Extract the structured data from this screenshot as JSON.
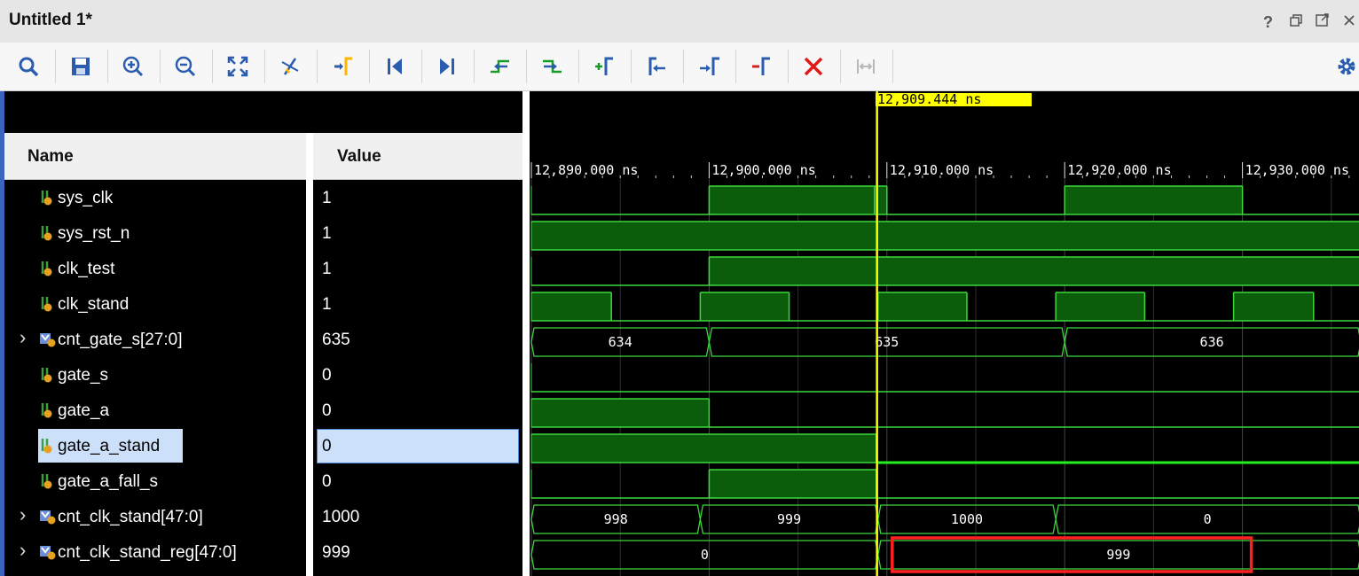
{
  "window": {
    "title": "Untitled 1*"
  },
  "title_icons": [
    "help-icon",
    "restore-icon",
    "maximize-icon",
    "close-icon"
  ],
  "toolbar": {
    "buttons": [
      {
        "name": "search-icon",
        "tooltip": "Search"
      },
      {
        "name": "save-icon",
        "tooltip": "Save Waveform Configuration"
      },
      {
        "name": "zoom-in-icon",
        "tooltip": "Zoom In"
      },
      {
        "name": "zoom-out-icon",
        "tooltip": "Zoom Out"
      },
      {
        "name": "zoom-fit-icon",
        "tooltip": "Zoom Fit"
      },
      {
        "name": "go-to-cursor-icon",
        "tooltip": "Go To Cursor"
      },
      {
        "name": "swap-cursors-icon",
        "tooltip": "Swap Cursors"
      },
      {
        "name": "go-to-time-0-icon",
        "tooltip": "Go To Time 0"
      },
      {
        "name": "go-to-last-time-icon",
        "tooltip": "Go To Last Time"
      },
      {
        "name": "previous-transition-icon",
        "tooltip": "Previous Transition"
      },
      {
        "name": "next-transition-icon",
        "tooltip": "Next Transition"
      },
      {
        "name": "add-marker-icon",
        "tooltip": "Add Marker"
      },
      {
        "name": "previous-marker-icon",
        "tooltip": "Previous Marker"
      },
      {
        "name": "next-marker-icon",
        "tooltip": "Next Marker"
      },
      {
        "name": "delete-marker-icon",
        "tooltip": "Delete Marker"
      },
      {
        "name": "delete-all-markers-icon",
        "tooltip": "Delete All Markers"
      },
      {
        "name": "snap-to-transition-icon",
        "tooltip": "Snap To Transition"
      },
      {
        "name": "settings-gear-icon",
        "tooltip": "Settings"
      }
    ]
  },
  "panel": {
    "name_header": "Name",
    "value_header": "Value"
  },
  "signals": [
    {
      "name": "sys_clk",
      "value": "1",
      "bus": false
    },
    {
      "name": "sys_rst_n",
      "value": "1",
      "bus": false
    },
    {
      "name": "clk_test",
      "value": "1",
      "bus": false
    },
    {
      "name": "clk_stand",
      "value": "1",
      "bus": false
    },
    {
      "name": "cnt_gate_s[27:0]",
      "value": "635",
      "bus": true
    },
    {
      "name": "gate_s",
      "value": "0",
      "bus": false
    },
    {
      "name": "gate_a",
      "value": "0",
      "bus": false
    },
    {
      "name": "gate_a_stand",
      "value": "0",
      "bus": false,
      "selected": true
    },
    {
      "name": "gate_a_fall_s",
      "value": "0",
      "bus": false
    },
    {
      "name": "cnt_clk_stand[47:0]",
      "value": "1000",
      "bus": true
    },
    {
      "name": "cnt_clk_stand_reg[47:0]",
      "value": "999",
      "bus": true
    }
  ],
  "cursor": {
    "label": "12,909.444 ns",
    "time_ns": 12909.444
  },
  "timescale": {
    "start_ns": 12889.9,
    "ns_per_unit": 0.0499,
    "ticks": [
      "12,890.000 ns",
      "12,900.000 ns",
      "12,910.000 ns",
      "12,920.000 ns",
      "12,930.000 ns"
    ],
    "tick_times_ns": [
      12890,
      12900,
      12910,
      12920,
      12930
    ]
  },
  "waves": {
    "sys_clk": [
      [
        12890,
        0
      ],
      [
        12900,
        1
      ],
      [
        12909.3,
        1
      ],
      [
        12910,
        0
      ],
      [
        12920,
        1
      ],
      [
        12930,
        0
      ]
    ],
    "sys_rst_n": [
      [
        12890,
        1
      ]
    ],
    "clk_test": [
      [
        12890,
        0
      ],
      [
        12900,
        1
      ]
    ],
    "clk_stand": [
      [
        12890,
        1
      ],
      [
        12894.5,
        0
      ],
      [
        12899.5,
        1
      ],
      [
        12904.5,
        0
      ],
      [
        12909.5,
        1
      ],
      [
        12914.5,
        0
      ],
      [
        12919.5,
        1
      ],
      [
        12924.5,
        0
      ],
      [
        12929.5,
        1
      ],
      [
        12934,
        0
      ]
    ],
    "cnt_gate_s": [
      {
        "start": 12889,
        "end": 12900,
        "label": "634"
      },
      {
        "start": 12900,
        "end": 12920,
        "label": "635"
      },
      {
        "start": 12920,
        "end": 12937,
        "label": "636"
      }
    ],
    "gate_s": [
      [
        12890,
        0
      ]
    ],
    "gate_a": [
      [
        12890,
        1
      ],
      [
        12900,
        0
      ]
    ],
    "gate_a_stand": [
      [
        12890,
        1
      ],
      [
        12909.4,
        0
      ]
    ],
    "gate_a_fall_s": [
      [
        12890,
        0
      ],
      [
        12900,
        1
      ],
      [
        12909.4,
        0
      ]
    ],
    "cnt_clk_stand": [
      {
        "start": 12889,
        "end": 12899.5,
        "label": "998"
      },
      {
        "start": 12899.5,
        "end": 12909.5,
        "label": "999"
      },
      {
        "start": 12909.5,
        "end": 12919.5,
        "label": "1000"
      },
      {
        "start": 12919.5,
        "end": 12937,
        "label": "0"
      }
    ],
    "cnt_clk_stand_reg": [
      {
        "start": 12889,
        "end": 12909.5,
        "label": "0"
      },
      {
        "start": 12909.5,
        "end": 12937,
        "label": "999"
      }
    ]
  },
  "highlight": {
    "color": "#ff2020",
    "signal": "cnt_clk_stand_reg",
    "start_ns": 12910.3,
    "end_ns": 12930.5
  },
  "colors": {
    "wave_line": "#3cd83c",
    "wave_fill": "#0b5d0b",
    "cursor": "#ffff00",
    "grid": "#454545",
    "selection": "#cde0fa"
  }
}
